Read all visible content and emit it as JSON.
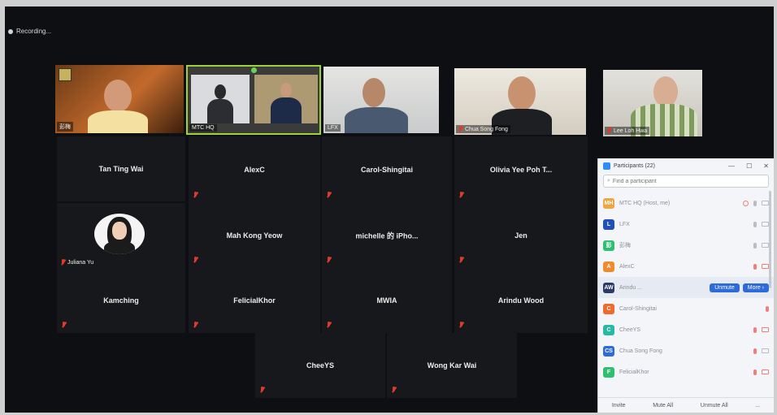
{
  "recording": {
    "label": "Recording..."
  },
  "videos": [
    {
      "label": "彭梅",
      "muted": false
    },
    {
      "label": "MTC HQ",
      "muted": false
    },
    {
      "label": "LFX",
      "muted": false
    },
    {
      "label": "Chua Song Fong",
      "muted": true
    },
    {
      "label": "Lee Loh Hwa",
      "muted": true
    }
  ],
  "tiles": [
    {
      "name": "Tan Ting Wai"
    },
    {
      "name": "AlexC"
    },
    {
      "name": "Carol-Shingitai"
    },
    {
      "name": "Olivia Yee Poh T..."
    },
    {
      "name": "Juliana Yu"
    },
    {
      "name": "Mah Kong Yeow"
    },
    {
      "name": "michelle 的 iPho..."
    },
    {
      "name": "Jen"
    },
    {
      "name": "Kamching"
    },
    {
      "name": "FelicialKhor"
    },
    {
      "name": "MWIA"
    },
    {
      "name": "Arindu Wood"
    },
    {
      "name": "CheeYS"
    },
    {
      "name": "Wong Kar Wai"
    }
  ],
  "participants_panel": {
    "title": "Participants (22)",
    "search_placeholder": "Find a participant",
    "rows": [
      {
        "initials": "MH",
        "name": "MTC HQ (Host, me)",
        "color": "#f0a640"
      },
      {
        "initials": "L",
        "name": "LFX",
        "color": "#1f4fb8"
      },
      {
        "initials": "彭",
        "name": "彭梅",
        "color": "#2fbf71"
      },
      {
        "initials": "A",
        "name": "AlexC",
        "color": "#f08a2c"
      },
      {
        "initials": "AW",
        "name": "Arindu ...",
        "color": "#2b3a67"
      },
      {
        "initials": "C",
        "name": "Carol-Shingitai",
        "color": "#f06a2c"
      },
      {
        "initials": "C",
        "name": "CheeYS",
        "color": "#27b9a2"
      },
      {
        "initials": "CS",
        "name": "Chua Song Fong",
        "color": "#2d6bd8"
      },
      {
        "initials": "F",
        "name": "FelicialKhor",
        "color": "#2fbf71"
      }
    ],
    "unmute_label": "Unmute",
    "more_label": "More ›",
    "footer": {
      "invite": "Invite",
      "mute_all": "Mute All",
      "unmute_all": "Unmute All",
      "more": "..."
    }
  }
}
